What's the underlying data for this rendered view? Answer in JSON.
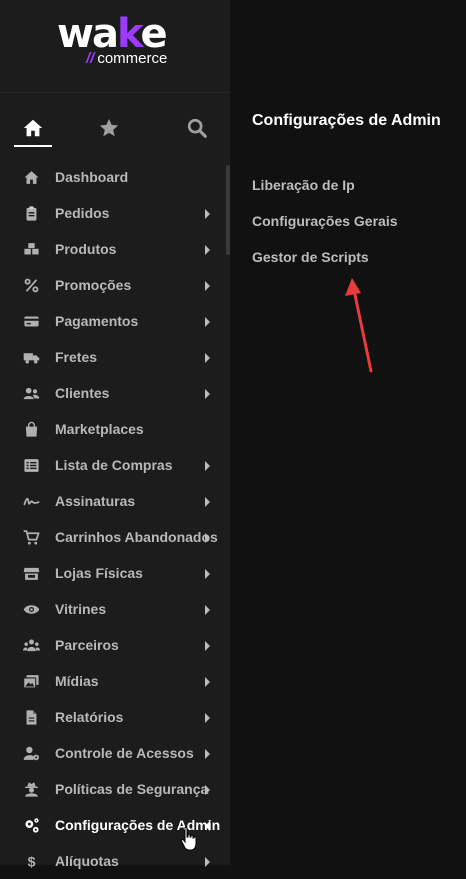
{
  "brand": {
    "logo_main": "wake",
    "logo_sub": "commerce"
  },
  "top_icons": [
    "home-icon",
    "star-icon",
    "search-icon"
  ],
  "menu": [
    {
      "label": "Dashboard",
      "icon": "home-icon",
      "has_arrow": false
    },
    {
      "label": "Pedidos",
      "icon": "clipboard-icon",
      "has_arrow": true
    },
    {
      "label": "Produtos",
      "icon": "boxes-icon",
      "has_arrow": true
    },
    {
      "label": "Promoções",
      "icon": "percent-icon",
      "has_arrow": true
    },
    {
      "label": "Pagamentos",
      "icon": "credit-card-icon",
      "has_arrow": true
    },
    {
      "label": "Fretes",
      "icon": "truck-icon",
      "has_arrow": true
    },
    {
      "label": "Clientes",
      "icon": "users-icon",
      "has_arrow": true
    },
    {
      "label": "Marketplaces",
      "icon": "shopping-bag-icon",
      "has_arrow": false
    },
    {
      "label": "Lista de Compras",
      "icon": "list-icon",
      "has_arrow": true
    },
    {
      "label": "Assinaturas",
      "icon": "signature-icon",
      "has_arrow": true
    },
    {
      "label": "Carrinhos Abandonados",
      "icon": "cart-icon",
      "has_arrow": true
    },
    {
      "label": "Lojas Físicas",
      "icon": "store-icon",
      "has_arrow": true
    },
    {
      "label": "Vitrines",
      "icon": "eye-icon",
      "has_arrow": true
    },
    {
      "label": "Parceiros",
      "icon": "partners-icon",
      "has_arrow": true
    },
    {
      "label": "Mídias",
      "icon": "images-icon",
      "has_arrow": true
    },
    {
      "label": "Relatórios",
      "icon": "file-icon",
      "has_arrow": true
    },
    {
      "label": "Controle de Acessos",
      "icon": "user-cog-icon",
      "has_arrow": true
    },
    {
      "label": "Políticas de Segurança",
      "icon": "user-secret-icon",
      "has_arrow": true
    },
    {
      "label": "Configurações de Admin",
      "icon": "cogs-icon",
      "has_arrow": true,
      "active": true
    },
    {
      "label": "Alíquotas",
      "icon": "dollar-icon",
      "has_arrow": true
    }
  ],
  "submenu": {
    "title": "Configurações de Admin",
    "items": [
      "Liberação de Ip",
      "Configurações Gerais",
      "Gestor de Scripts"
    ]
  },
  "colors": {
    "accent": "#9b3bff",
    "annotation_arrow": "#e83c3c",
    "sidebar_bg": "#1c1c1c",
    "panel_bg": "#111111"
  }
}
